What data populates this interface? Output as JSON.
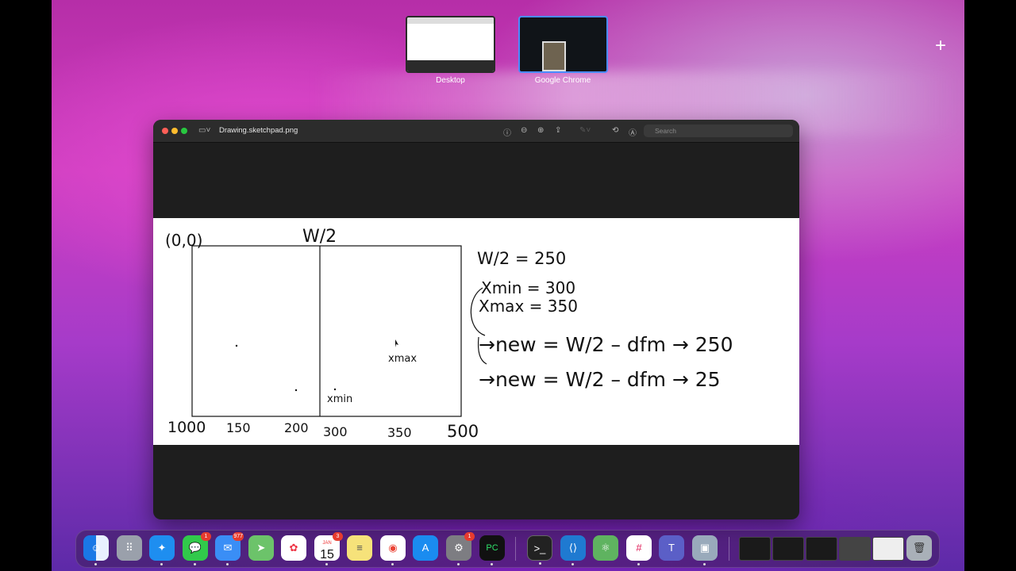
{
  "spaces": [
    {
      "label": "Desktop"
    },
    {
      "label": "Google Chrome"
    }
  ],
  "window": {
    "title": "Drawing.sketchpad.png",
    "search_placeholder": "Search"
  },
  "drawing": {
    "origin": "(0,0)",
    "center_label": "W/2",
    "axis_ticks": [
      "1000",
      "150",
      "200",
      "300",
      "350",
      "500"
    ],
    "marker_xmin": "xmin",
    "marker_xmax": "xmax",
    "notes": [
      "W/2 = 250",
      "Xmin = 300",
      "Xmax = 350",
      "→new = W/2 – dfm → 250",
      "→new = W/2 – dfm → 25"
    ]
  },
  "dock": {
    "mail_badge": "977",
    "messages_badge": "1",
    "calendar_badge": "3",
    "settings_badge": "1",
    "calendar_month": "JAN",
    "calendar_day": "15"
  }
}
